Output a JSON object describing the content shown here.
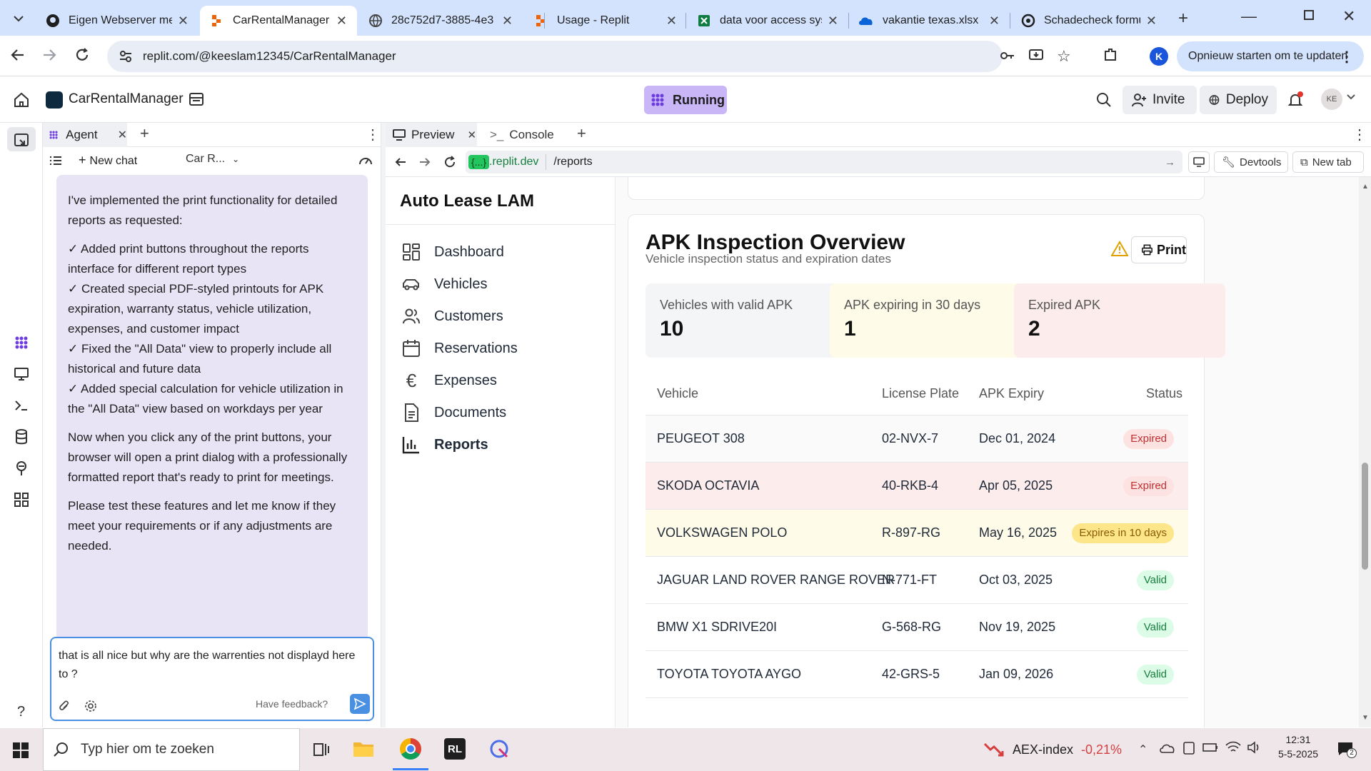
{
  "browser": {
    "tabs": [
      {
        "title": "Eigen Webserver met"
      },
      {
        "title": "CarRentalManager - I"
      },
      {
        "title": "28c752d7-3885-4e3"
      },
      {
        "title": "Usage - Replit"
      },
      {
        "title": "data voor access syst"
      },
      {
        "title": "vakantie texas.xlsx"
      },
      {
        "title": "Schadecheck formuli"
      }
    ],
    "url": "replit.com/@keeslam12345/CarRentalManager",
    "restart_label": "Opnieuw starten om te updaten",
    "profile_initial": "K"
  },
  "replit": {
    "project_name": "CarRentalManager",
    "status": "Running",
    "invite_label": "Invite",
    "deploy_label": "Deploy",
    "avatar_initials": "KE"
  },
  "agent": {
    "tab_label": "Agent",
    "new_chat_label": "New chat",
    "context_label": "Car R...",
    "message_intro": "I've implemented the print functionality for detailed reports as requested:",
    "message_points": [
      "✓ Added print buttons throughout the reports interface for different report types",
      "✓ Created special PDF-styled printouts for APK expiration, warranty status, vehicle utilization, expenses, and customer impact",
      "✓ Fixed the \"All Data\" view to properly include all historical and future data",
      "✓ Added special calculation for vehicle utilization in the \"All Data\" view based on workdays per year"
    ],
    "message_p2": "Now when you click any of the print buttons, your browser will open a print dialog with a professionally formatted report that's ready to print for meetings.",
    "message_p3": "Please test these features and let me know if they meet your requirements or if any adjustments are needed.",
    "input_value": "that is all nice but why are the warrenties not displayd here to ?",
    "feedback_label": "Have feedback?"
  },
  "preview": {
    "tab_preview": "Preview",
    "tab_console": "Console",
    "domain_badge": "{...}",
    "domain": ".replit.dev",
    "path": "/reports",
    "devtools_label": "Devtools",
    "newtab_label": "New tab"
  },
  "app": {
    "brand": "Auto Lease LAM",
    "nav": [
      {
        "label": "Dashboard",
        "icon": "dashboard-icon"
      },
      {
        "label": "Vehicles",
        "icon": "car-icon"
      },
      {
        "label": "Customers",
        "icon": "users-icon"
      },
      {
        "label": "Reservations",
        "icon": "calendar-icon"
      },
      {
        "label": "Expenses",
        "icon": "euro-icon"
      },
      {
        "label": "Documents",
        "icon": "document-icon"
      },
      {
        "label": "Reports",
        "icon": "chart-icon"
      }
    ],
    "report": {
      "title": "APK Inspection Overview",
      "subtitle": "Vehicle inspection status and expiration dates",
      "print_label": "Print",
      "stats": [
        {
          "label": "Vehicles with valid APK",
          "value": "10"
        },
        {
          "label": "APK expiring in 30 days",
          "value": "1"
        },
        {
          "label": "Expired APK",
          "value": "2"
        }
      ],
      "columns": [
        "Vehicle",
        "License Plate",
        "APK Expiry",
        "Status"
      ],
      "rows": [
        {
          "vehicle": "PEUGEOT 308",
          "plate": "02-NVX-7",
          "expiry": "Dec 01, 2024",
          "status": "Expired"
        },
        {
          "vehicle": "SKODA OCTAVIA",
          "plate": "40-RKB-4",
          "expiry": "Apr 05, 2025",
          "status": "Expired"
        },
        {
          "vehicle": "VOLKSWAGEN POLO",
          "plate": "R-897-RG",
          "expiry": "May 16, 2025",
          "status": "Expires in 10 days"
        },
        {
          "vehicle": "JAGUAR LAND ROVER RANGE ROVER",
          "plate": "N-771-FT",
          "expiry": "Oct 03, 2025",
          "status": "Valid"
        },
        {
          "vehicle": "BMW X1 SDRIVE20I",
          "plate": "G-568-RG",
          "expiry": "Nov 19, 2025",
          "status": "Valid"
        },
        {
          "vehicle": "TOYOTA TOYOTA AYGO",
          "plate": "42-GRS-5",
          "expiry": "Jan 09, 2026",
          "status": "Valid"
        }
      ]
    }
  },
  "taskbar": {
    "search_placeholder": "Typ hier om te zoeken",
    "ticker_name": "AEX-index",
    "ticker_change": "-0,21%",
    "time": "12:31",
    "date": "5-5-2025"
  },
  "colors": {
    "accent": "#4a90e2",
    "running": "#c9b6f7",
    "agent_bubble": "#e8e4f6",
    "expired_row": "#fdecec",
    "warning_row": "#fefbe8"
  }
}
